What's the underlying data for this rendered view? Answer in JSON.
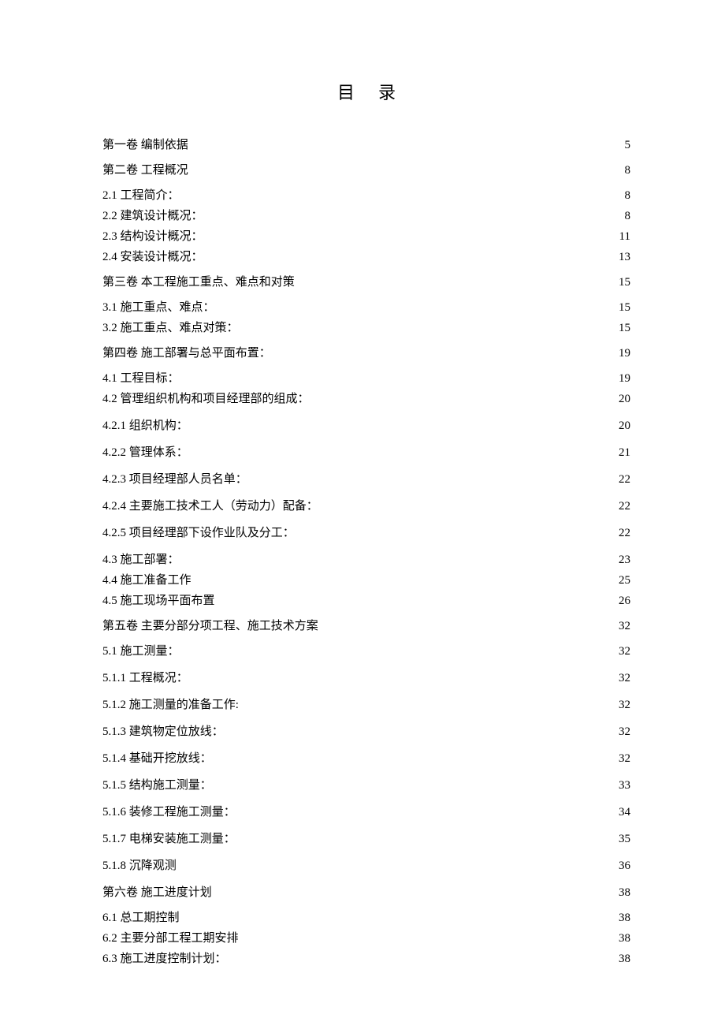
{
  "title": "目录",
  "entries": [
    {
      "label": "第一卷 编制依据",
      "page": "5",
      "level": "volume"
    },
    {
      "label": "第二卷 工程概况",
      "page": "8",
      "level": "volume"
    },
    {
      "label": "2.1 工程简介：",
      "page": "8",
      "level": "sub1"
    },
    {
      "label": "2.2 建筑设计概况：",
      "page": "8",
      "level": "sub1"
    },
    {
      "label": "2.3 结构设计概况：",
      "page": "11",
      "level": "sub1"
    },
    {
      "label": "2.4 安装设计概况：",
      "page": "13",
      "level": "sub1"
    },
    {
      "label": "第三卷 本工程施工重点、难点和对策",
      "page": "15",
      "level": "volume"
    },
    {
      "label": "3.1 施工重点、难点：",
      "page": "15",
      "level": "sub1"
    },
    {
      "label": "3.2 施工重点、难点对策：",
      "page": "15",
      "level": "sub1"
    },
    {
      "label": "第四卷 施工部署与总平面布置：",
      "page": "19",
      "level": "volume"
    },
    {
      "label": "4.1 工程目标：",
      "page": "19",
      "level": "sub1"
    },
    {
      "label": "4.2 管理组织机构和项目经理部的组成：",
      "page": "20",
      "level": "sub1"
    },
    {
      "label": "4.2.1 组织机构：",
      "page": "20",
      "level": "sub2"
    },
    {
      "label": "4.2.2 管理体系：",
      "page": "21",
      "level": "sub2"
    },
    {
      "label": "4.2.3  项目经理部人员名单：",
      "page": "22",
      "level": "sub2"
    },
    {
      "label": "4.2.4 主要施工技术工人（劳动力）配备：",
      "page": "22",
      "level": "sub2"
    },
    {
      "label": "4.2.5 项目经理部下设作业队及分工：",
      "page": "22",
      "level": "sub2"
    },
    {
      "label": "4.3 施工部署：",
      "page": "23",
      "level": "sub1"
    },
    {
      "label": "4.4 施工准备工作",
      "page": "25",
      "level": "sub1"
    },
    {
      "label": "4.5 施工现场平面布置",
      "page": "26",
      "level": "sub1"
    },
    {
      "label": "第五卷 主要分部分项工程、施工技术方案",
      "page": "32",
      "level": "volume"
    },
    {
      "label": "5.1 施工测量：",
      "page": "32",
      "level": "sub1"
    },
    {
      "label": "5.1.1 工程概况：",
      "page": "32",
      "level": "sub2"
    },
    {
      "label": "5.1.2 施工测量的准备工作:",
      "page": "32",
      "level": "sub2"
    },
    {
      "label": "5.1.3 建筑物定位放线：",
      "page": "32",
      "level": "sub2"
    },
    {
      "label": "5.1.4 基础开挖放线：",
      "page": "32",
      "level": "sub2"
    },
    {
      "label": "5.1.5 结构施工测量：",
      "page": "33",
      "level": "sub2"
    },
    {
      "label": "5.1.6 装修工程施工测量：",
      "page": "34",
      "level": "sub2"
    },
    {
      "label": "5.1.7 电梯安装施工测量：",
      "page": "35",
      "level": "sub2"
    },
    {
      "label": "5.1.8 沉降观测",
      "page": "36",
      "level": "sub2"
    },
    {
      "label": "第六卷 施工进度计划",
      "page": "38",
      "level": "volume"
    },
    {
      "label": "6.1 总工期控制",
      "page": "38",
      "level": "sub1"
    },
    {
      "label": "6.2 主要分部工程工期安排",
      "page": "38",
      "level": "sub1"
    },
    {
      "label": "6.3 施工进度控制计划：",
      "page": "38",
      "level": "sub1"
    }
  ]
}
